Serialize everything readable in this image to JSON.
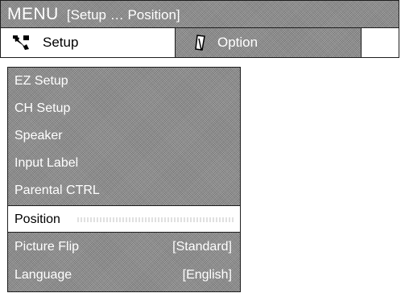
{
  "header": {
    "menu_word": "MENU",
    "breadcrumb": "[Setup … Position]"
  },
  "tabs": [
    {
      "label": "Setup",
      "icon": "wrench-icon",
      "active": true
    },
    {
      "label": "Option",
      "icon": "card-icon",
      "active": false
    }
  ],
  "menu": {
    "items": [
      {
        "label": "EZ Setup",
        "value": ""
      },
      {
        "label": "CH Setup",
        "value": ""
      },
      {
        "label": "Speaker",
        "value": ""
      },
      {
        "label": "Input Label",
        "value": ""
      },
      {
        "label": "Parental CTRL",
        "value": ""
      },
      {
        "label": "Position",
        "value": "",
        "selected": true
      },
      {
        "label": "Picture Flip",
        "value": "[Standard]"
      },
      {
        "label": "Language",
        "value": "[English]"
      }
    ]
  },
  "colors": {
    "panel": "#8e8e8e",
    "selected_bg": "#ffffff",
    "text_light": "#ffffff",
    "text_dark": "#000000"
  }
}
